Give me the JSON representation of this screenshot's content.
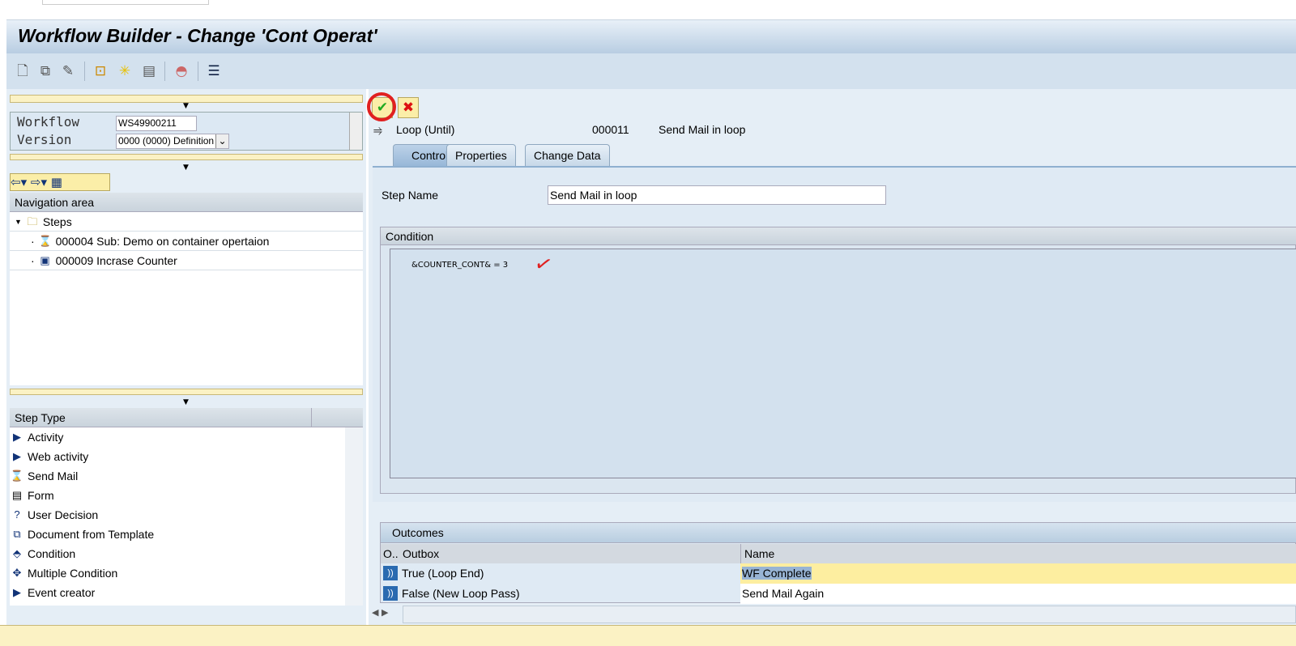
{
  "window": {
    "title": "Workflow Builder - Change 'Cont Operat'"
  },
  "toolbar": {
    "icons": [
      "new-document-icon",
      "copy-icon",
      "edit-pencil-icon",
      "hierarchy-icon",
      "sparkle-icon",
      "print-icon",
      "hat-icon",
      "layout-icon"
    ]
  },
  "workflow_box": {
    "workflow_label": "Workflow",
    "workflow_value": "WS49900211",
    "version_label": "Version",
    "version_value": "0000 (0000) Definition"
  },
  "navigation": {
    "header": "Navigation area",
    "root": "Steps",
    "items": [
      {
        "label": "000004 Sub: Demo on container opertaion",
        "icon": "send-mail-icon"
      },
      {
        "label": "000009 Incrase Counter",
        "icon": "container-operation-icon"
      }
    ]
  },
  "step_types": {
    "header": "Step Type",
    "items": [
      "Activity",
      "Web activity",
      "Send Mail",
      "Form",
      "User Decision",
      "Document from Template",
      "Condition",
      "Multiple Condition",
      "Event creator"
    ]
  },
  "step_header": {
    "type": "Loop (Until)",
    "number": "000011",
    "name": "Send Mail in loop"
  },
  "tabs": [
    {
      "label": "Control",
      "active": true
    },
    {
      "label": "Properties"
    },
    {
      "label": "Change Data"
    }
  ],
  "control": {
    "step_name_label": "Step Name",
    "step_name_value": "Send Mail in loop",
    "condition_header": "Condition",
    "condition_text": "&COUNTER_CONT& = 3"
  },
  "outcomes": {
    "header": "Outcomes",
    "columns": [
      "O..",
      "Outbox",
      "Name"
    ],
    "rows": [
      {
        "outbox": "True (Loop End)",
        "name": "WF Complete",
        "selected": true
      },
      {
        "outbox": "False (New Loop Pass)",
        "name": "Send Mail Again"
      }
    ]
  },
  "colors": {
    "annotation": "#e02020",
    "accent": "#8fb0d0"
  }
}
